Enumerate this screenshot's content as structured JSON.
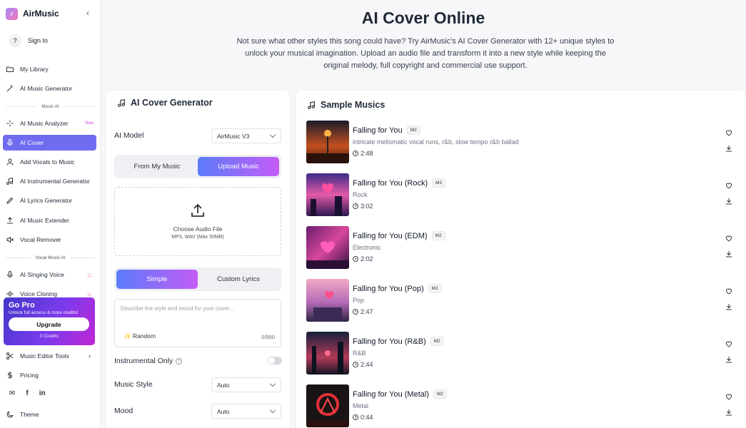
{
  "brand": {
    "name": "AirMusic",
    "collapse_icon": "‹"
  },
  "sidebar": {
    "sign_in": "Sign In",
    "sign_in_icon": "?",
    "items": [
      {
        "label": "My Library",
        "icon": "folder-icon"
      },
      {
        "label": "AI Music Generator",
        "icon": "magic-wand-icon"
      },
      {
        "label": "AI Music Analyzer",
        "icon": "sparkle-icon",
        "tag": "New"
      },
      {
        "label": "AI Cover",
        "icon": "microphone-icon",
        "active": true
      },
      {
        "label": "Add Vocals to Music",
        "icon": "person-icon"
      },
      {
        "label": "AI Instrumental Generator",
        "icon": "music-note-icon"
      },
      {
        "label": "AI Lyrics Generator",
        "icon": "pen-icon"
      },
      {
        "label": "AI Music Extender",
        "icon": "upload-icon"
      },
      {
        "label": "Vocal Remover",
        "icon": "speaker-mute-icon"
      },
      {
        "label": "AI Singing Voice",
        "icon": "microphone-icon",
        "tag": "fire"
      },
      {
        "label": "Voice Cloning",
        "icon": "waveform-icon",
        "tag": "fire"
      },
      {
        "label": "Music Editor Tools",
        "icon": "scissors-icon"
      },
      {
        "label": "Pricing",
        "icon": "dollar-icon"
      },
      {
        "label": "Theme",
        "icon": "moon-icon"
      }
    ],
    "sections": [
      "Music AI",
      "Vocal Music AI"
    ],
    "promo": {
      "title": "Go Pro",
      "subtitle": "Unlock full access & more credits!",
      "button": "Upgrade",
      "credits": "0 Credits"
    },
    "socials": [
      "mail-icon",
      "facebook-icon",
      "linkedin-icon"
    ]
  },
  "hero": {
    "title": "AI Cover Online",
    "description": "Not sure what other styles this song could have? Try AirMusic's AI Cover Generator with 12+ unique styles to unlock your musical imagination. Upload an audio file and transform it into a new style while keeping the original melody, full copyright and commercial use support."
  },
  "generator": {
    "title": "AI Cover Generator",
    "model_label": "AI Model",
    "model_value": "AirMusic V3",
    "source_tabs": [
      "From My Music",
      "Upload Music"
    ],
    "upload": {
      "title": "Choose Audio File",
      "hint": "MP3, WAV (Max 50MB)"
    },
    "mode_tabs": [
      "Simple",
      "Custom Lyrics"
    ],
    "prompt_placeholder": "Describe the style and mood for your cover...",
    "random_label": "✨ Random",
    "char_count": "0/500",
    "instrumental_label": "Instrumental Only",
    "instrumental_on": false,
    "style_label": "Music Style",
    "style_value": "Auto",
    "mood_label": "Mood",
    "mood_value": "Auto"
  },
  "samples": {
    "title": "Sample Musics",
    "tracks": [
      {
        "title": "Falling for You",
        "badge": "M2",
        "desc": "intricate melismatic vocal runs, r&b, slow tempo r&b ballad",
        "duration": "2:48"
      },
      {
        "title": "Falling for You (Rock)",
        "badge": "M2",
        "desc": "Rock",
        "duration": "3:02"
      },
      {
        "title": "Falling for You (EDM)",
        "badge": "M2",
        "desc": "Electronic",
        "duration": "2:02"
      },
      {
        "title": "Falling for You (Pop)",
        "badge": "M2",
        "desc": "Pop",
        "duration": "2:47"
      },
      {
        "title": "Falling for You (R&B)",
        "badge": "M2",
        "desc": "R&B",
        "duration": "2:44"
      },
      {
        "title": "Falling for You (Metal)",
        "badge": "M2",
        "desc": "Metal",
        "duration": "0:44"
      }
    ]
  }
}
